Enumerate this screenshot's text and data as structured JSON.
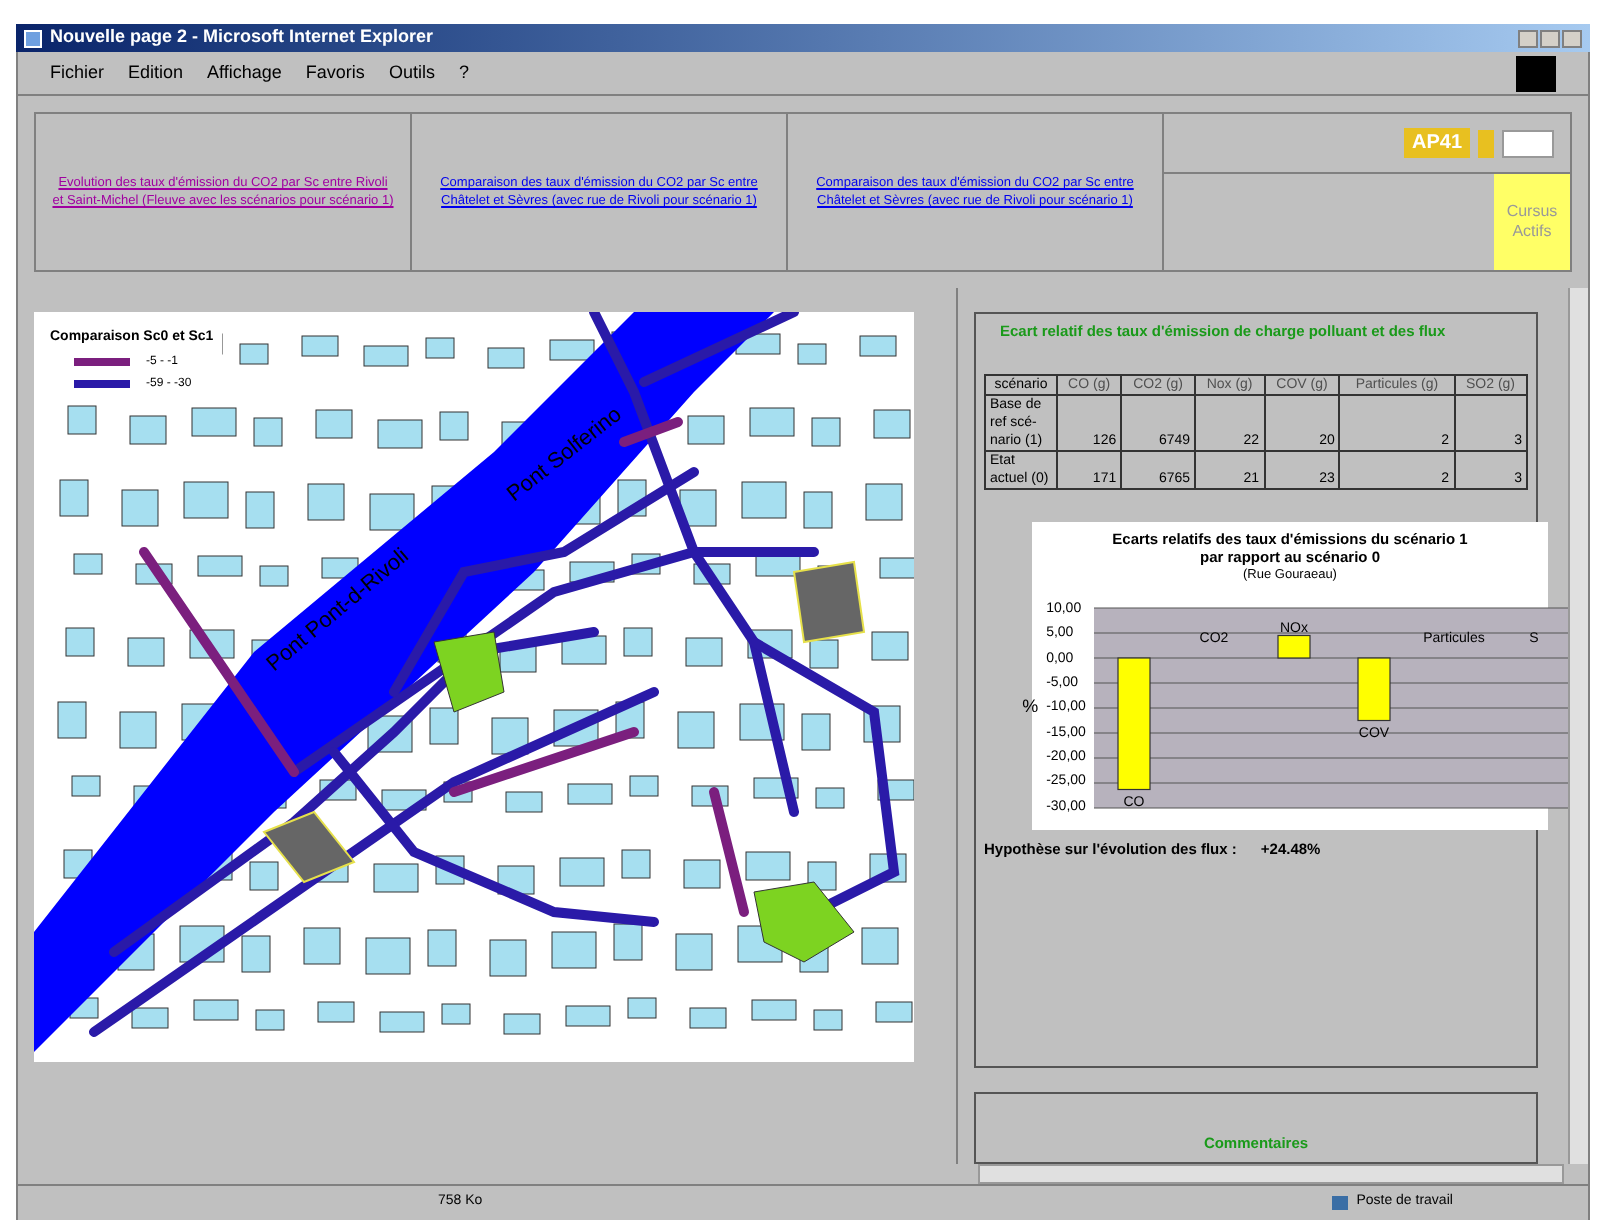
{
  "window": {
    "title": "Nouvelle page 2 - Microsoft Internet Explorer"
  },
  "menu": [
    "Fichier",
    "Edition",
    "Affichage",
    "Favoris",
    "Outils",
    "?"
  ],
  "links": [
    {
      "text": "Evolution des taux d'émission du CO2 par Sc entre Rivoli et Saint-Michel (Fleuve avec les scénarios pour scénario 1)",
      "visited": true
    },
    {
      "text": "Comparaison des taux d'émission du CO2 par Sc entre Châtelet et Sèvres (avec rue de Rivoli pour scénario 1)",
      "visited": false
    },
    {
      "text": "Comparaison des taux d'émission du CO2 par Sc entre Châtelet et Sèvres (avec rue de Rivoli pour scénario 1)",
      "visited": false
    }
  ],
  "logo": {
    "text": "AP41"
  },
  "side_button": {
    "text": "Cursus Actifs"
  },
  "map": {
    "legend_title": "Comparaison Sc0 et Sc1",
    "legend": [
      {
        "label": "-5 - -1",
        "color": "#7b1f7e"
      },
      {
        "label": "-59 - -30",
        "color": "#2a1aa8"
      }
    ],
    "labels": [
      "Pont Solferino",
      "Pont Pont-d-Rivoli"
    ]
  },
  "panel": {
    "heading": "Ecart relatif des taux d'émission de charge polluant et des flux",
    "table": {
      "columns": [
        "scénario",
        "CO (g)",
        "CO2 (g)",
        "Nox (g)",
        "COV (g)",
        "Particules (g)",
        "SO2 (g)"
      ],
      "rows": [
        [
          "Base de ref scé-nario (1)",
          "126",
          "6749",
          "22",
          "20",
          "2",
          "3"
        ],
        [
          "Etat actuel (0)",
          "171",
          "6765",
          "21",
          "23",
          "2",
          "3"
        ]
      ]
    },
    "chart": {
      "title": "Ecarts relatifs des taux d'émissions du scénario 1 par rapport au scénario 0",
      "subtitle": "(Rue Gouraeau)",
      "chart_data": {
        "type": "bar",
        "ylabel": "%",
        "categories": [
          "CO",
          "CO2",
          "NOx",
          "COV",
          "Particules",
          "S"
        ],
        "values": [
          -26.3,
          0,
          4.5,
          -12.5,
          0,
          0
        ],
        "ylim": [
          -30,
          10
        ],
        "yticks": [
          {
            "value": 10,
            "label": "10,00"
          },
          {
            "value": 5,
            "label": "5,00"
          },
          {
            "value": 0,
            "label": "0,00"
          },
          {
            "value": -5,
            "label": "-5,00"
          },
          {
            "value": -10,
            "label": "-10,00"
          },
          {
            "value": -15,
            "label": "-15,00"
          },
          {
            "value": -20,
            "label": "-20,00"
          },
          {
            "value": -25,
            "label": "-25,00"
          },
          {
            "value": -30,
            "label": "-30,00"
          }
        ],
        "grid": true
      }
    },
    "hypothesis": "Hypothèse sur l'évolution des flux :",
    "hypothesis_value": "+24.48%"
  },
  "comments": {
    "heading": "Commentaires"
  },
  "status_bar": {
    "size": "758 Ko",
    "zone": "Poste de travail"
  }
}
